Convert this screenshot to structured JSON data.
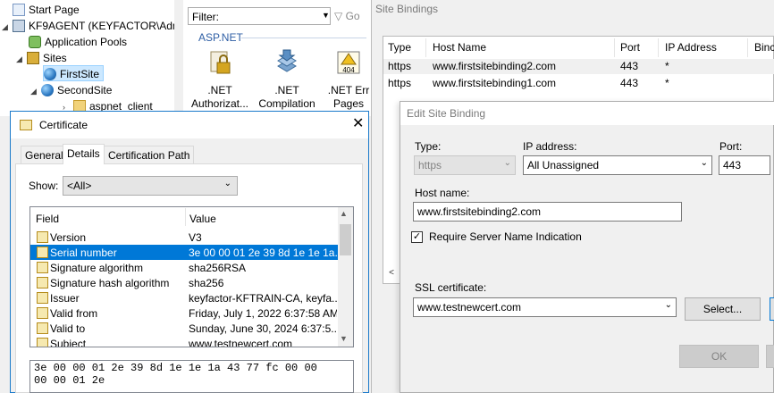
{
  "tree": {
    "start_page": "Start Page",
    "server": "KF9AGENT (KEYFACTOR\\Adm",
    "app_pools": "Application Pools",
    "sites": "Sites",
    "first_site": "FirstSite",
    "second_site": "SecondSite",
    "aspnet_client": "aspnet_client"
  },
  "features": {
    "filter_label": "Filter:",
    "go_label": "Go",
    "group": "ASP.NET",
    "items": [
      {
        "line1": ".NET",
        "line2": "Authorizat..."
      },
      {
        "line1": ".NET",
        "line2": "Compilation"
      },
      {
        "line1": ".NET Err",
        "line2": "Pages"
      }
    ],
    "icon_404": "404"
  },
  "site_bindings": {
    "title": "Site Bindings",
    "columns": [
      "Type",
      "Host Name",
      "Port",
      "IP Address",
      "Binc"
    ],
    "rows": [
      {
        "type": "https",
        "host": "www.firstsitebinding2.com",
        "port": "443",
        "ip": "*"
      },
      {
        "type": "https",
        "host": "www.firstsitebinding1.com",
        "port": "443",
        "ip": "*"
      }
    ],
    "scroll_left": "<"
  },
  "edit_binding": {
    "title": "Edit Site Binding",
    "type_label": "Type:",
    "type_value": "https",
    "ip_label": "IP address:",
    "ip_value": "All Unassigned",
    "port_label": "Port:",
    "port_value": "443",
    "host_label": "Host name:",
    "host_value": "www.firstsitebinding2.com",
    "sni_label": "Require Server Name Indication",
    "sni_checked": true,
    "ssl_label": "SSL certificate:",
    "ssl_value": "www.testnewcert.com",
    "select_button": "Select...",
    "ok_button": "OK"
  },
  "certificate": {
    "title": "Certificate",
    "close_glyph": "✕",
    "tabs": [
      "General",
      "Details",
      "Certification Path"
    ],
    "active_tab": "Details",
    "show_label": "Show:",
    "show_value": "<All>",
    "field_header": "Field",
    "value_header": "Value",
    "fields": [
      {
        "name": "Version",
        "value": "V3"
      },
      {
        "name": "Serial number",
        "value": "3e 00 00 01 2e 39 8d 1e 1e 1a..."
      },
      {
        "name": "Signature algorithm",
        "value": "sha256RSA"
      },
      {
        "name": "Signature hash algorithm",
        "value": "sha256"
      },
      {
        "name": "Issuer",
        "value": "keyfactor-KFTRAIN-CA, keyfa..."
      },
      {
        "name": "Valid from",
        "value": "Friday, July 1, 2022 6:37:58 AM"
      },
      {
        "name": "Valid to",
        "value": "Sunday, June 30, 2024 6:37:5..."
      },
      {
        "name": "Subject",
        "value": "www.testnewcert.com"
      }
    ],
    "selected_field": "Serial number",
    "detail_value": "3e 00 00 01 2e 39 8d 1e 1e 1a 43 77 fc 00 00\n00 00 01 2e"
  }
}
